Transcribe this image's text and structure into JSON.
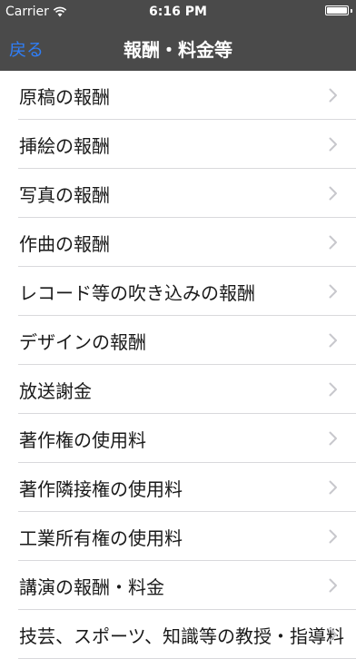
{
  "status_bar": {
    "carrier": "Carrier",
    "time": "6:16 PM",
    "wifi_icon": "wifi-icon",
    "battery_icon": "battery-icon"
  },
  "nav": {
    "back_label": "戻る",
    "title": "報酬・料金等"
  },
  "colors": {
    "nav_background": "#4a4a4a",
    "back_link": "#2f7ef7",
    "separator": "#d9d9dc",
    "chevron": "#c7c7cc"
  },
  "items": [
    {
      "label": "原稿の報酬"
    },
    {
      "label": "挿絵の報酬"
    },
    {
      "label": "写真の報酬"
    },
    {
      "label": "作曲の報酬"
    },
    {
      "label": "レコード等の吹き込みの報酬"
    },
    {
      "label": "デザインの報酬"
    },
    {
      "label": "放送謝金"
    },
    {
      "label": "著作権の使用料"
    },
    {
      "label": "著作隣接権の使用料"
    },
    {
      "label": "工業所有権の使用料"
    },
    {
      "label": "講演の報酬・料金"
    },
    {
      "label": "技芸、スポーツ、知識等の教授・指導料"
    }
  ]
}
